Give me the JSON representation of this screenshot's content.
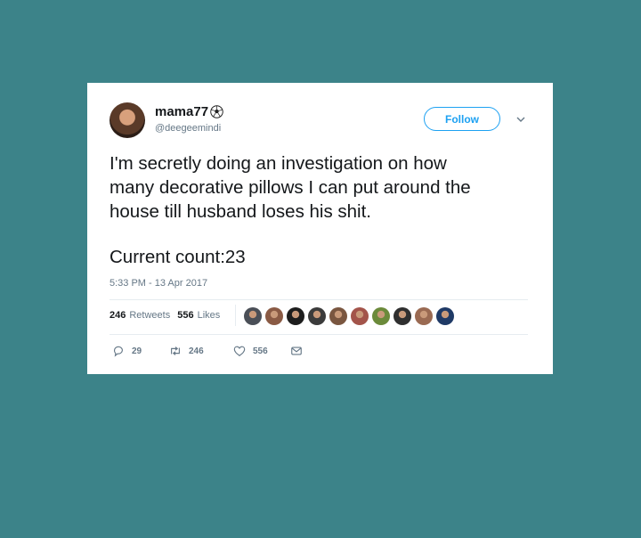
{
  "tweet": {
    "display_name": "mama77",
    "name_emoji_icon": "soccer-ball-icon",
    "handle": "@deegeemindi",
    "follow_label": "Follow",
    "text_main": "I'm secretly doing an investigation on how\nmany decorative pillows I can put around the\nhouse till husband loses his shit.",
    "text_count": "Current count:23",
    "timestamp": "5:33 PM - 13 Apr 2017",
    "retweets_count": "246",
    "retweets_label": "Retweets",
    "likes_count": "556",
    "likes_label": "Likes",
    "liker_avatars": [
      "#4a4f57",
      "#8a5a44",
      "#1d1d1d",
      "#3b3b3b",
      "#7a5640",
      "#a3544a",
      "#6b8a3a",
      "#2f2f2f",
      "#9a6a52",
      "#1f3a66"
    ],
    "actions": {
      "reply_count": "29",
      "retweet_count": "246",
      "like_count": "556"
    }
  },
  "colors": {
    "background": "#3c8389",
    "accent": "#1da1f2",
    "secondary_text": "#657786"
  }
}
